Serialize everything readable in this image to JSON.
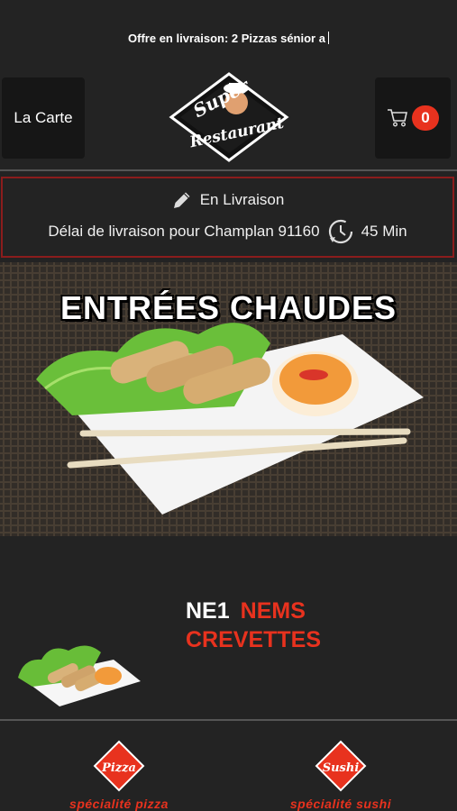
{
  "promo": {
    "text": "Offre en livraison: 2 Pizzas sénior a"
  },
  "header": {
    "menu_label": "La Carte",
    "cart_count": "0",
    "logo": {
      "top_word": "Super",
      "bottom_word": "Restaurant"
    }
  },
  "delivery": {
    "mode": "En Livraison",
    "delay_text": "Délai de livraison pour Champlan 91160",
    "delay_time": "45 Min"
  },
  "hero": {
    "title": "ENTRÉES CHAUDES"
  },
  "product": {
    "code": "NE1",
    "name": "NEMS CREVETTES"
  },
  "bottom_nav": [
    {
      "label": "spécialité pizza",
      "logo_word": "Pizza"
    },
    {
      "label": "spécialité sushi",
      "logo_word": "Sushi"
    }
  ],
  "colors": {
    "accent": "#e8321e",
    "background": "#232323",
    "panel": "#161616",
    "border": "#8b1c1c"
  },
  "icons": [
    "cart-icon",
    "pencil-icon",
    "clock-icon"
  ]
}
